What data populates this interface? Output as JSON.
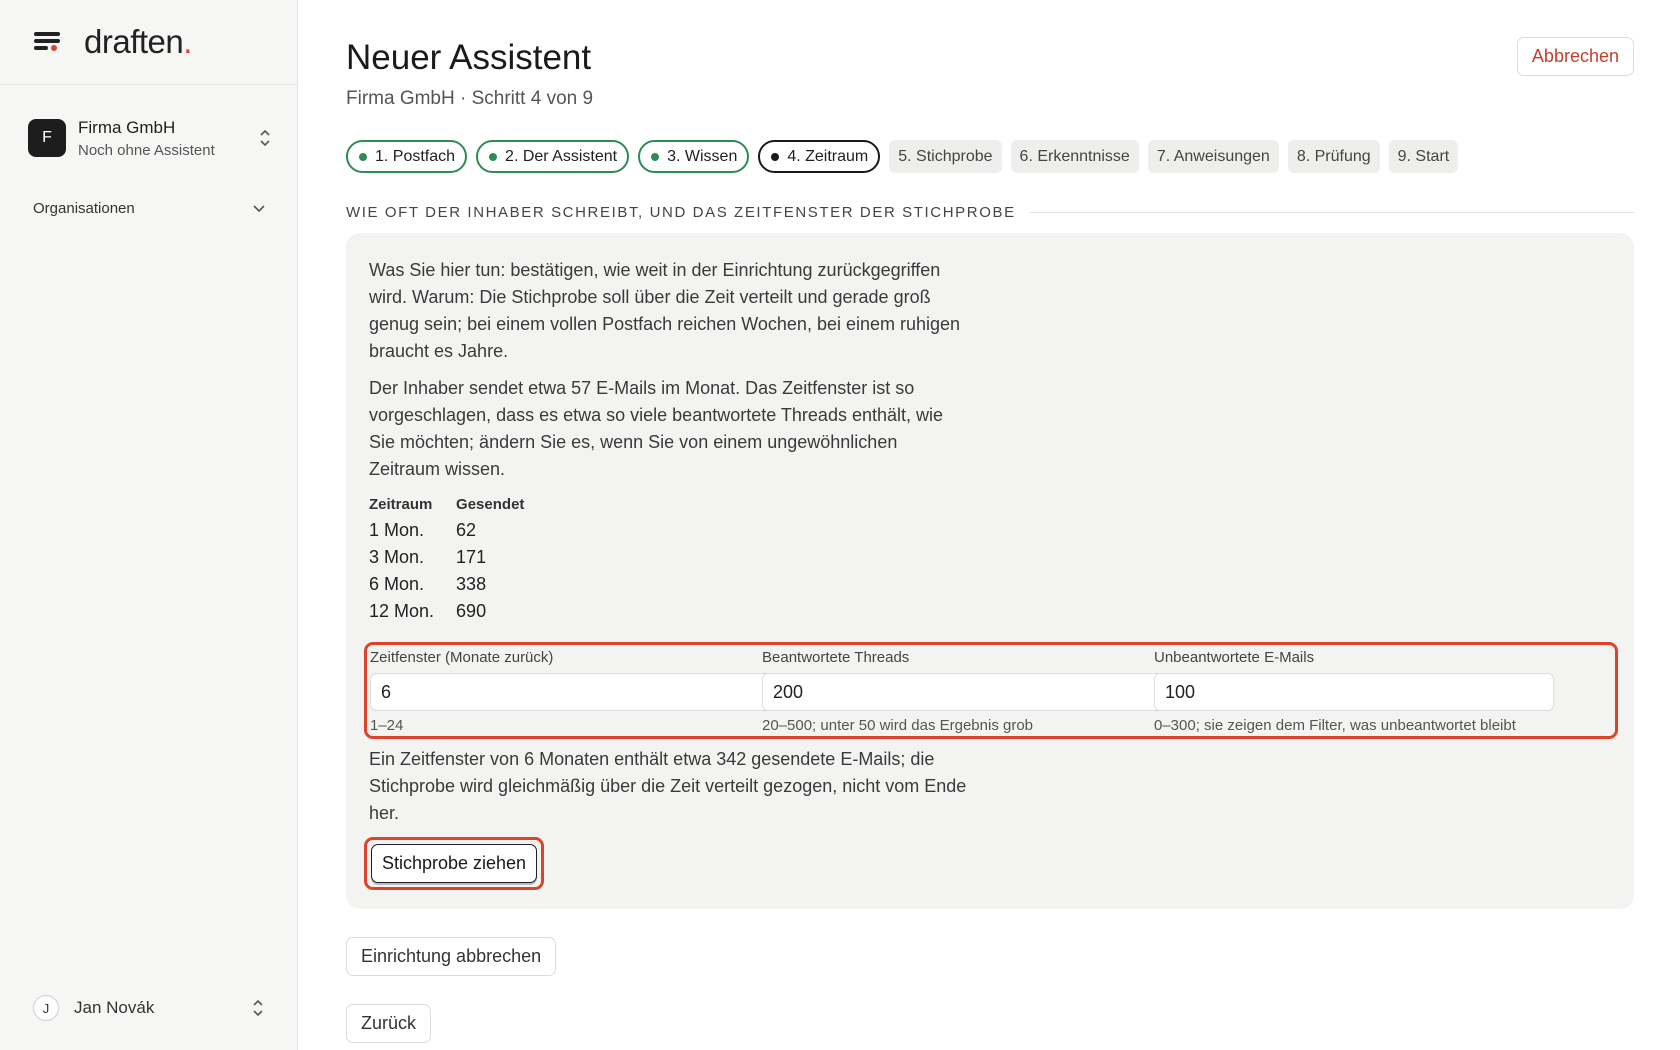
{
  "brand": {
    "logo_text": "draften",
    "logo_dot": ".",
    "accent_color": "#d9442b"
  },
  "sidebar": {
    "org": {
      "avatar": "F",
      "name": "Firma GmbH",
      "subtitle": "Noch ohne Assistent"
    },
    "section_label": "Organisationen",
    "user": {
      "avatar": "J",
      "name": "Jan Novák"
    }
  },
  "header": {
    "title": "Neuer Assistent",
    "subtitle": "Firma GmbH · Schritt 4 von 9",
    "cancel_label": "Abbrechen"
  },
  "steps": [
    {
      "label": "1. Postfach",
      "status": "done"
    },
    {
      "label": "2. Der Assistent",
      "status": "done"
    },
    {
      "label": "3. Wissen",
      "status": "done"
    },
    {
      "label": "4. Zeitraum",
      "status": "current"
    },
    {
      "label": "5. Stichprobe",
      "status": "todo"
    },
    {
      "label": "6. Erkenntnisse",
      "status": "todo"
    },
    {
      "label": "7. Anweisungen",
      "status": "todo"
    },
    {
      "label": "8. Prüfung",
      "status": "todo"
    },
    {
      "label": "9. Start",
      "status": "todo"
    }
  ],
  "section": {
    "heading": "WIE OFT DER INHABER SCHREIBT, UND DAS ZEITFENSTER DER STICHPROBE",
    "intro": "Was Sie hier tun: bestätigen, wie weit in der Einrichtung zurückgegriffen wird. Warum: Die Stichprobe soll über die Zeit verteilt und gerade groß genug sein; bei einem vollen Postfach reichen Wochen, bei einem ruhigen braucht es Jahre.",
    "volume_text": "Der Inhaber sendet etwa 57 E-Mails im Monat. Das Zeitfenster ist so vorgeschlagen, dass es etwa so viele beantwortete Threads enthält, wie Sie möchten; ändern Sie es, wenn Sie von einem ungewöhnlichen Zeitraum wissen.",
    "table": {
      "headers": [
        "Zeitraum",
        "Gesendet"
      ],
      "rows": [
        [
          "1 Mon.",
          "62"
        ],
        [
          "3 Mon.",
          "171"
        ],
        [
          "6 Mon.",
          "338"
        ],
        [
          "12 Mon.",
          "690"
        ]
      ]
    },
    "fields": {
      "window": {
        "label": "Zeitfenster (Monate zurück)",
        "value": "6",
        "hint": "1–24"
      },
      "answered": {
        "label": "Beantwortete Threads",
        "value": "200",
        "hint": "20–500; unter 50 wird das Ergebnis grob"
      },
      "unanswered": {
        "label": "Unbeantwortete E-Mails",
        "value": "100",
        "hint": "0–300; sie zeigen dem Filter, was unbeantwortet bleibt"
      }
    },
    "summary": "Ein Zeitfenster von 6 Monaten enthält etwa 342 gesendete E-Mails; die Stichprobe wird gleichmäßig über die Zeit verteilt gezogen, nicht vom Ende her.",
    "sample_button": "Stichprobe ziehen"
  },
  "footer": {
    "cancel_setup": "Einrichtung abbrechen",
    "back": "Zurück"
  }
}
